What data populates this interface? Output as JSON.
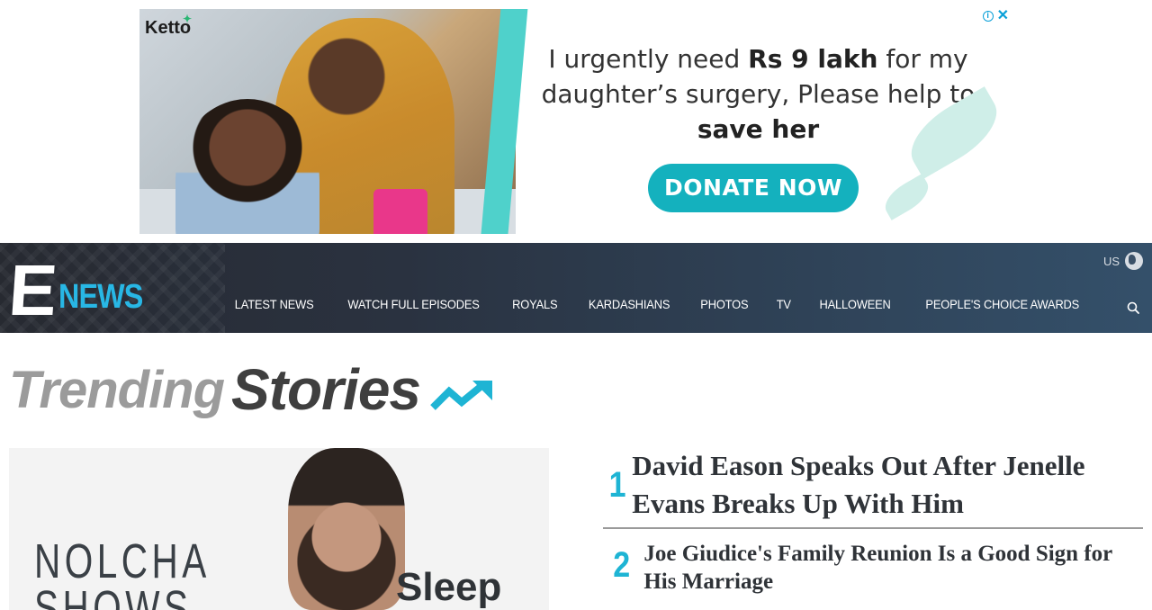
{
  "ad": {
    "brand": "Ketto",
    "line1_pre": "I urgently need ",
    "line1_bold": "Rs 9 lakh",
    "line1_post": " for my",
    "line2": "daughter’s surgery, Please help to",
    "line3_bold": "save her",
    "cta": "DONATE NOW",
    "info_icon": "i",
    "close_icon": "✕"
  },
  "header": {
    "logo_e": "E",
    "logo_news": "NEWS",
    "edition": "US",
    "nav": [
      {
        "label": "Latest News"
      },
      {
        "label": "Watch Full Episodes"
      },
      {
        "label": "Royals"
      },
      {
        "label": "Kardashians"
      },
      {
        "label": "Photos"
      },
      {
        "label": "TV"
      },
      {
        "label": "Halloween"
      },
      {
        "label": "People's Choice Awards"
      }
    ]
  },
  "trending": {
    "word1": "Trending",
    "word2": "Stories"
  },
  "hero": {
    "banner": "NOLCHA\nSHOWS",
    "brand": "Sleep"
  },
  "stories": [
    {
      "rank": "1",
      "title": "David Eason Speaks Out After Jenelle Evans Breaks Up With Him"
    },
    {
      "rank": "2",
      "title": "Joe Giudice's Family Reunion Is a Good Sign for His Marriage"
    }
  ],
  "colors": {
    "accent": "#1eb4d4",
    "cta": "#14b1be",
    "nav_bg": "#2a3240"
  }
}
